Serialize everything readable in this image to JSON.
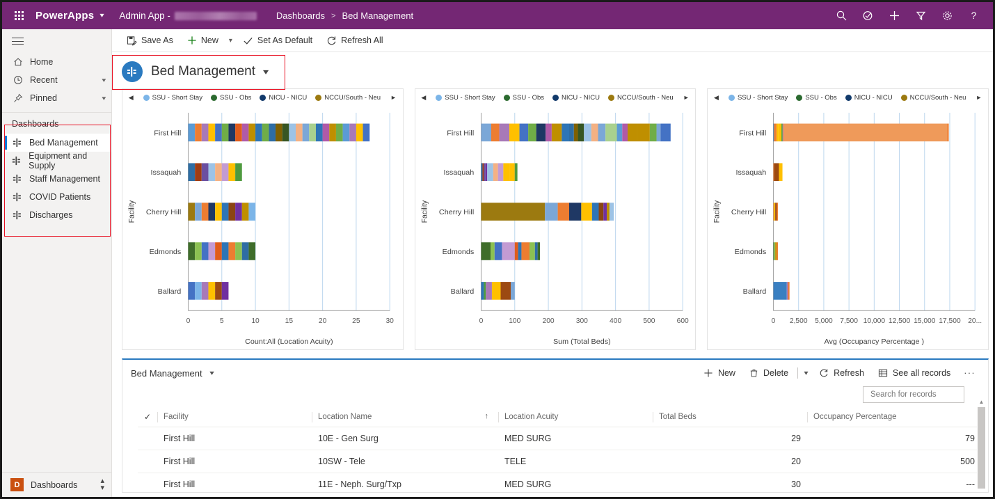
{
  "topbar": {
    "waffle": "app-launcher",
    "brand": "PowerApps",
    "app_name": "Admin App -",
    "breadcrumb": [
      "Dashboards",
      "Bed Management"
    ],
    "breadcrumb_sep": ">",
    "icons": [
      "search-icon",
      "relevance-search-icon",
      "quick-create-icon",
      "filter-icon",
      "settings-icon",
      "help-icon"
    ],
    "bar_color": "#742774"
  },
  "commandbar": {
    "save_as": "Save As",
    "new": "New",
    "set_as_default": "Set As Default",
    "refresh_all": "Refresh All"
  },
  "sidebar": {
    "nav": [
      {
        "label": "Home",
        "icon": "home-icon",
        "caret": false
      },
      {
        "label": "Recent",
        "icon": "clock-icon",
        "caret": true
      },
      {
        "label": "Pinned",
        "icon": "pin-icon",
        "caret": true
      }
    ],
    "group_title": "Dashboards",
    "dashboards": [
      {
        "label": "Bed Management",
        "selected": true
      },
      {
        "label": "Equipment and Supply",
        "selected": false
      },
      {
        "label": "Staff Management",
        "selected": false
      },
      {
        "label": "COVID Patients",
        "selected": false
      },
      {
        "label": "Discharges",
        "selected": false
      }
    ],
    "area_switcher": {
      "badge": "D",
      "label": "Dashboards"
    }
  },
  "page": {
    "title": "Bed Management"
  },
  "legend": {
    "prev": "◀",
    "next": "►",
    "items": [
      {
        "label": "SSU - Short Stay",
        "color": "#7cb5e8"
      },
      {
        "label": "SSU - Obs",
        "color": "#2b6a2f"
      },
      {
        "label": "NICU - NICU",
        "color": "#123a6b"
      },
      {
        "label": "NCCU/South - Neu",
        "color": "#9c7a10"
      }
    ]
  },
  "chart_data": [
    {
      "type": "bar",
      "orientation": "horizontal",
      "stacked": true,
      "title": "",
      "xlabel": "Count:All (Location Acuity)",
      "ylabel": "Facility",
      "categories": [
        "First Hill",
        "Issaquah",
        "Cherry Hill",
        "Edmonds",
        "Ballard"
      ],
      "values": [
        27,
        8,
        10,
        10,
        6
      ],
      "xlim": [
        0,
        30
      ],
      "xticks": [
        0,
        5,
        10,
        15,
        20,
        25,
        30
      ],
      "grid": true,
      "legend_position": "top",
      "segments": [
        [
          1,
          1,
          1,
          1,
          1,
          1,
          1,
          1,
          1,
          1,
          1,
          1,
          1,
          1,
          1,
          1,
          1,
          1,
          1,
          1,
          1,
          1,
          1,
          1,
          1,
          1,
          1
        ],
        [
          1,
          1,
          1,
          1,
          1,
          1,
          1,
          1
        ],
        [
          1,
          1,
          1,
          1,
          1,
          1,
          1,
          1,
          1,
          1
        ],
        [
          1,
          1,
          1,
          1,
          1,
          1,
          1,
          1,
          1,
          1
        ],
        [
          1,
          1,
          1,
          1,
          1,
          1
        ]
      ],
      "segment_colors": [
        [
          "#5b9bd5",
          "#ed7d31",
          "#a879b8",
          "#ffc000",
          "#4472c4",
          "#70ad47",
          "#1f3864",
          "#e05c1b",
          "#b05aa8",
          "#bf8f00",
          "#2e75b6",
          "#70ad47",
          "#2e6da4",
          "#7f6000",
          "#375623",
          "#9dc3e6",
          "#f4b183",
          "#7ba7d7",
          "#a9d18e",
          "#2e75b6",
          "#b05aa8",
          "#bf8f00",
          "#70ad47",
          "#5b9bd5",
          "#a879b8",
          "#ffc000",
          "#4472c4"
        ],
        [
          "#2e6da4",
          "#a03c12",
          "#6b4fa0",
          "#9dc3e6",
          "#f4b183",
          "#c39bd3",
          "#ffc000",
          "#4e9a3e"
        ],
        [
          "#9c7a10",
          "#7ba7d7",
          "#ed7d31",
          "#1f3864",
          "#ffc000",
          "#2e75b6",
          "#8b4513",
          "#7030a0",
          "#bf8f00",
          "#7cb5e8"
        ],
        [
          "#3f6d2a",
          "#8cc152",
          "#4472c4",
          "#c39bd3",
          "#e05c1b",
          "#2e75b6",
          "#ed7d31",
          "#8cc152",
          "#2e6da4",
          "#3f6d2a"
        ],
        [
          "#4472c4",
          "#7cb5e8",
          "#a879b8",
          "#ffc000",
          "#9c4a12",
          "#7030a0"
        ]
      ]
    },
    {
      "type": "bar",
      "orientation": "horizontal",
      "stacked": true,
      "title": "",
      "xlabel": "Sum (Total Beds)",
      "ylabel": "Facility",
      "categories": [
        "First Hill",
        "Issaquah",
        "Cherry Hill",
        "Edmonds",
        "Ballard"
      ],
      "values": [
        565,
        108,
        395,
        175,
        100
      ],
      "xlim": [
        0,
        600
      ],
      "xticks": [
        0,
        100,
        200,
        300,
        400,
        500,
        600
      ],
      "grid": true,
      "legend_position": "top",
      "segments": [
        [
          30,
          24,
          30,
          30,
          26,
          24,
          28,
          18,
          30,
          22,
          14,
          12,
          18,
          22,
          20,
          22,
          34,
          16,
          16,
          28,
          38,
          20,
          12,
          30
        ],
        [
          4,
          4,
          5,
          5,
          18,
          14,
          16,
          18,
          16,
          8
        ],
        [
          190,
          38,
          34,
          36,
          32,
          20,
          14,
          10,
          8,
          13
        ],
        [
          28,
          12,
          22,
          38,
          10,
          10,
          24,
          16,
          8,
          7
        ],
        [
          8,
          6,
          18,
          26,
          30,
          12
        ]
      ],
      "segment_colors": [
        [
          "#7ba7d7",
          "#ed7d31",
          "#a879b8",
          "#ffc000",
          "#4472c4",
          "#70ad47",
          "#1f3864",
          "#b05aa8",
          "#bf8f00",
          "#2e75b6",
          "#2e6da4",
          "#7f6000",
          "#375623",
          "#9dc3e6",
          "#f4b183",
          "#7ba7d7",
          "#a9d18e",
          "#5b9bd5",
          "#b05aa8",
          "#bf8f00",
          "#bf8f00",
          "#70ad47",
          "#7ba7d7",
          "#4472c4"
        ],
        [
          "#2e6da4",
          "#a03c12",
          "#6b4fa0",
          "#7030a0",
          "#9dc3e6",
          "#f4b183",
          "#c39bd3",
          "#ffc000",
          "#ffc000",
          "#4e9a3e"
        ],
        [
          "#9c7a10",
          "#7ba7d7",
          "#ed7d31",
          "#1f3864",
          "#ffc000",
          "#2e75b6",
          "#8b4513",
          "#7030a0",
          "#bf8f00",
          "#9dc3e6"
        ],
        [
          "#3f6d2a",
          "#8cc152",
          "#4472c4",
          "#c39bd3",
          "#e05c1b",
          "#2e75b6",
          "#ed7d31",
          "#8cc152",
          "#2e6da4",
          "#3f6d2a"
        ],
        [
          "#2e75b6",
          "#4e9a3e",
          "#a879b8",
          "#ffc000",
          "#9c4a12",
          "#7ba7d7"
        ]
      ]
    },
    {
      "type": "bar",
      "orientation": "horizontal",
      "stacked": true,
      "title": "",
      "xlabel": "Avg (Occupancy Percentage )",
      "ylabel": "Facility",
      "categories": [
        "First Hill",
        "Issaquah",
        "Cherry Hill",
        "Edmonds",
        "Ballard"
      ],
      "values": [
        17400,
        900,
        450,
        450,
        1600
      ],
      "xlim": [
        0,
        20000
      ],
      "xticks": [
        0,
        2500,
        5000,
        7500,
        10000,
        12500,
        15000,
        17500,
        20000
      ],
      "xticklabels": [
        "0",
        "2,500",
        "5,000",
        "7,500",
        "10,000",
        "12,500",
        "15,000",
        "17,500",
        "20..."
      ],
      "grid": true,
      "legend_position": "top",
      "segments": [
        [
          60,
          260,
          150,
          330,
          120,
          60,
          16280,
          140
        ],
        [
          70,
          480,
          350
        ],
        [
          60,
          120,
          160,
          110
        ],
        [
          60,
          120,
          150,
          120
        ],
        [
          1330,
          120,
          150
        ]
      ],
      "segment_colors": [
        [
          "#2e75b6",
          "#ed7d31",
          "#ffc000",
          "#ffc000",
          "#4e9a3e",
          "#b05aa8",
          "#ef9a5a",
          "#ed7d31"
        ],
        [
          "#ed7d31",
          "#9c4a12",
          "#ffc000"
        ],
        [
          "#ed7d31",
          "#ffc000",
          "#9c4a12",
          "#ed7d31"
        ],
        [
          "#3f6d2a",
          "#8cc152",
          "#bf8f00",
          "#ed7d31"
        ],
        [
          "#3a7fc1",
          "#a879b8",
          "#ed7d31"
        ]
      ]
    }
  ],
  "grid": {
    "title": "Bed Management",
    "commands": {
      "new": "New",
      "delete": "Delete",
      "refresh": "Refresh",
      "see_all": "See all records",
      "overflow": "···"
    },
    "search_placeholder": "Search for records",
    "search_value": "",
    "columns": [
      "Facility",
      "Location Name",
      "Location Acuity",
      "Total Beds",
      "Occupancy Percentage"
    ],
    "sorted_column": "Location Name",
    "sort_direction": "↑",
    "rows": [
      {
        "facility": "First Hill",
        "location_name": "10E - Gen Surg",
        "location_acuity": "MED SURG",
        "total_beds": "29",
        "occupancy": "79"
      },
      {
        "facility": "First Hill",
        "location_name": "10SW - Tele",
        "location_acuity": "TELE",
        "total_beds": "20",
        "occupancy": "500"
      },
      {
        "facility": "First Hill",
        "location_name": "11E - Neph. Surg/Txp",
        "location_acuity": "MED SURG",
        "total_beds": "30",
        "occupancy": "---"
      }
    ]
  }
}
